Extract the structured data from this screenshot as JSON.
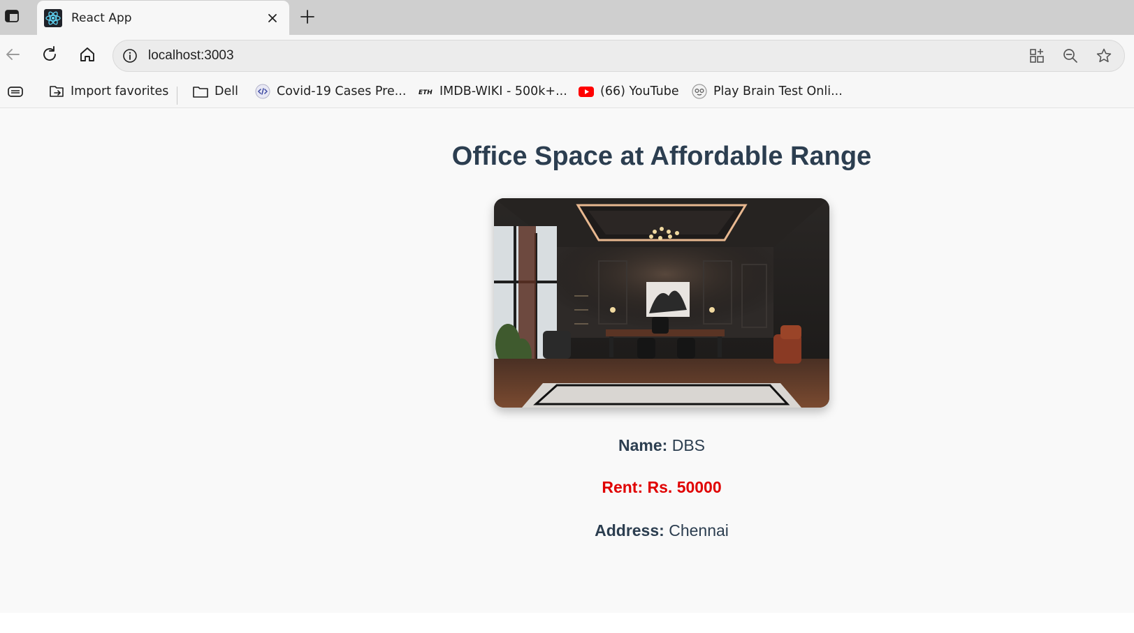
{
  "browser": {
    "tab": {
      "title": "React App"
    },
    "address": {
      "url": "localhost:3003"
    },
    "bookmarks": [
      {
        "label": "Import favorites",
        "icon": "import-favorites-icon"
      },
      {
        "label": "Dell",
        "icon": "folder-icon"
      },
      {
        "label": "Covid-19 Cases Pre...",
        "icon": "code-site-icon"
      },
      {
        "label": "IMDB-WIKI - 500k+...",
        "icon": "eth-site-icon"
      },
      {
        "label": "(66) YouTube",
        "icon": "youtube-icon"
      },
      {
        "label": "Play Brain Test Onli...",
        "icon": "game-site-icon"
      }
    ]
  },
  "page": {
    "heading": "Office Space at Affordable Range",
    "image_alt": "Office interior",
    "name": {
      "label": "Name:",
      "value": "DBS"
    },
    "rent": {
      "label": "Rent: Rs.",
      "value": "50000"
    },
    "address": {
      "label": "Address:",
      "value": "Chennai"
    }
  },
  "colors": {
    "heading": "#2c3e50",
    "rent": "#e00000",
    "tabstrip": "#cfcfcf",
    "page_bg": "#f9f9f9"
  }
}
